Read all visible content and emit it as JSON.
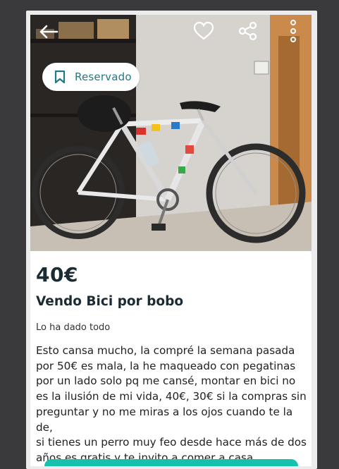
{
  "header": {
    "back_icon": "arrow-left-icon",
    "favorite_icon": "heart-icon",
    "share_icon": "share-icon",
    "more_icon": "more-vertical-icon"
  },
  "badge": {
    "label": "Reservado",
    "icon": "bookmark-icon",
    "color": "#1f7a84"
  },
  "listing": {
    "price": "40€",
    "title": "Vendo Bici por bobo",
    "condition": "Lo ha dado todo",
    "description": "Esto cansa mucho, la compré la semana pasada\npor 50€ es mala, la he maqueado con pegatinas\npor un lado solo pq me cansé, montar en bici no\nes la ilusión de mi vida, 40€, 30€ si la compras sin\npreguntar y no me miras a los ojos cuando te la de,\nsi tienes un perro muy feo desde hace más de dos\naños es gratis y te invito a comer a casa"
  },
  "colors": {
    "accent": "#13c1ac",
    "text": "#1b2b31"
  }
}
